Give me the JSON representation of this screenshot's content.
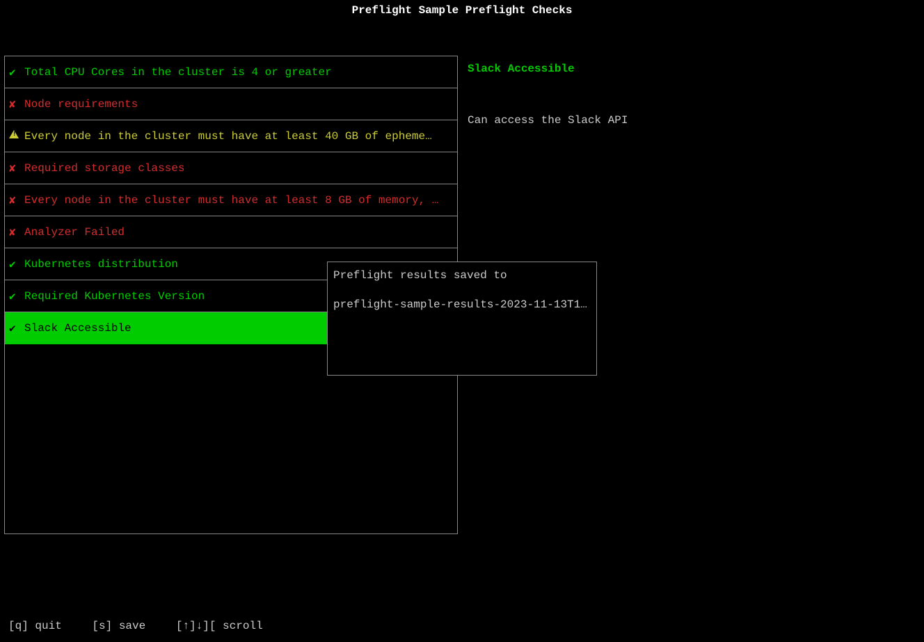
{
  "title": "Preflight Sample Preflight Checks",
  "checks": [
    {
      "status": "pass",
      "label": "Total CPU Cores in the cluster is 4 or greater"
    },
    {
      "status": "fail",
      "label": "Node requirements"
    },
    {
      "status": "warn",
      "label": "Every node in the cluster must have at least 40 GB of epheme…"
    },
    {
      "status": "fail",
      "label": "Required storage classes"
    },
    {
      "status": "fail",
      "label": "Every node in the cluster must have at least 8 GB of memory, …"
    },
    {
      "status": "fail",
      "label": "Analyzer Failed"
    },
    {
      "status": "pass",
      "label": "Kubernetes distribution"
    },
    {
      "status": "pass",
      "label": "Required Kubernetes Version"
    },
    {
      "status": "pass",
      "label": "Slack Accessible",
      "selected": true
    }
  ],
  "detail": {
    "title": "Slack Accessible",
    "body": "Can access the Slack API"
  },
  "popup": {
    "line1": "Preflight results saved to",
    "line2": "preflight-sample-results-2023-11-13T1…"
  },
  "footer": {
    "quit": "[q] quit",
    "save": "[s] save",
    "scroll": "[↑]↓][ scroll"
  },
  "icons": {
    "pass": "✔",
    "fail": "✘",
    "warn": "▲"
  }
}
